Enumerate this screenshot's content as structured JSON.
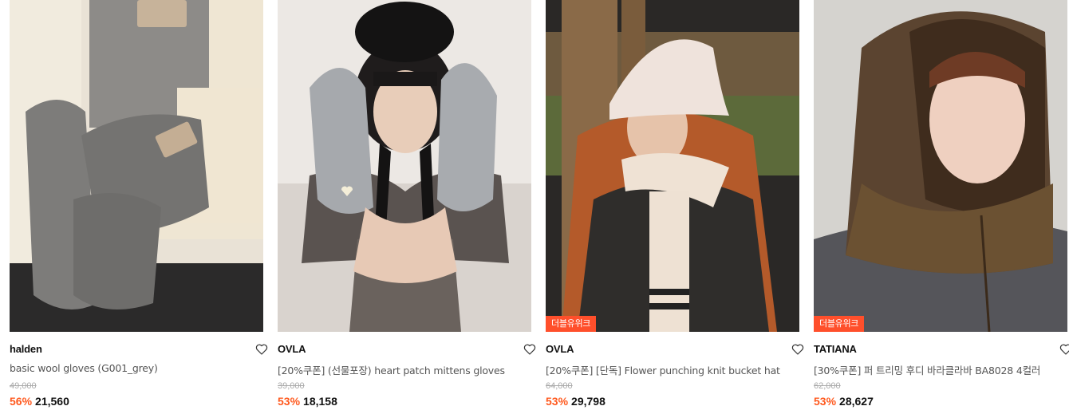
{
  "products": [
    {
      "brand": "halden",
      "name": "basic wool gloves (G001_grey)",
      "original_price": "49,000",
      "discount": "56%",
      "price": "21,560",
      "badge": "",
      "image_icon": "product-photo-gloves"
    },
    {
      "brand": "OVLA",
      "name": "[20%쿠폰] (선물포장) heart patch mittens gloves",
      "original_price": "39,000",
      "discount": "53%",
      "price": "18,158",
      "badge": "",
      "image_icon": "product-photo-mittens"
    },
    {
      "brand": "OVLA",
      "name": "[20%쿠폰] [단독] Flower punching knit bucket hat",
      "original_price": "64,000",
      "discount": "53%",
      "price": "29,798",
      "badge": "더블유위크",
      "image_icon": "product-photo-bucket-hat"
    },
    {
      "brand": "TATIANA",
      "name": "[30%쿠폰] 퍼 트리밍 후디 바라클라바 BA8028 4컬러",
      "original_price": "62,000",
      "discount": "53%",
      "price": "28,627",
      "badge": "더블유위크",
      "image_icon": "product-photo-balaclava"
    }
  ],
  "colors": {
    "discount": "#ff5a1f",
    "badge": "#ff4f2b",
    "original_price": "#aaaaaa"
  },
  "icons": {
    "wishlist": "heart-outline-icon"
  }
}
